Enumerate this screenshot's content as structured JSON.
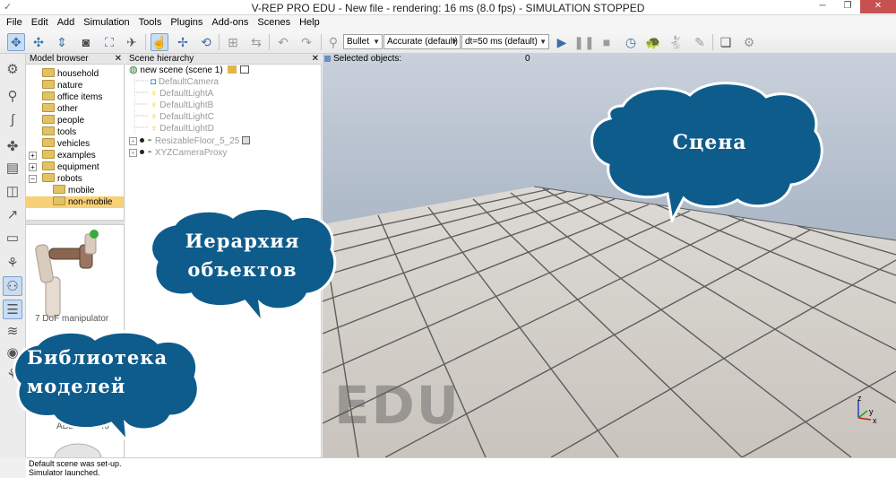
{
  "window": {
    "title": "V-REP PRO EDU - New file - rendering: 16 ms (8.0 fps) - SIMULATION STOPPED",
    "minimize": "─",
    "maximize": "❐",
    "close": "✕"
  },
  "menu": [
    "File",
    "Edit",
    "Add",
    "Simulation",
    "Tools",
    "Plugins",
    "Add-ons",
    "Scenes",
    "Help"
  ],
  "toolbar": {
    "engine": "Bullet",
    "accuracy": "Accurate (default)",
    "timestep": "dt=50 ms (default)"
  },
  "model_browser": {
    "title": "Model browser",
    "close": "✕",
    "items": [
      {
        "label": "household",
        "expander": ""
      },
      {
        "label": "nature",
        "expander": ""
      },
      {
        "label": "office items",
        "expander": ""
      },
      {
        "label": "other",
        "expander": ""
      },
      {
        "label": "people",
        "expander": ""
      },
      {
        "label": "tools",
        "expander": ""
      },
      {
        "label": "vehicles",
        "expander": ""
      },
      {
        "label": "examples",
        "expander": "+"
      },
      {
        "label": "equipment",
        "expander": "+"
      },
      {
        "label": "robots",
        "expander": "−"
      },
      {
        "label": "mobile",
        "expander": ""
      },
      {
        "label": "non-mobile",
        "expander": ""
      }
    ],
    "thumbnails": [
      "7 DoF manipulator",
      "ABB IRB 140"
    ]
  },
  "scene_hierarchy": {
    "title": "Scene hierarchy",
    "close": "✕",
    "root": "new scene (scene 1)",
    "items": [
      "DefaultCamera",
      "DefaultLightA",
      "DefaultLightB",
      "DefaultLightC",
      "DefaultLightD",
      "ResizableFloor_5_25",
      "XYZCameraProxy"
    ]
  },
  "scene": {
    "selected_label": "Selected objects:",
    "selected_count": "0",
    "watermark": "EDU",
    "axes": {
      "x": "x",
      "y": "y",
      "z": "z"
    }
  },
  "status": {
    "lines": [
      "Default scene was set-up.",
      "Simulator launched."
    ]
  },
  "annotations": {
    "scene": "Сцена",
    "hierarchy_line1": "Иерархия",
    "hierarchy_line2": "объектов",
    "library_line1": "Библиотека",
    "library_line2": "моделей"
  },
  "colors": {
    "bubble": "#0e5c8c",
    "bubble_outline": "#ffffff",
    "selection": "#f7d178",
    "active_tool": "#c8ddf3"
  },
  "icons": {
    "toolbar": [
      "move-camera-icon",
      "rotate-camera-icon",
      "shift-camera-icon",
      "camera-icon",
      "fit-view-icon",
      "dragonfly-icon",
      "click-select-icon",
      "object-shift-icon",
      "object-rotate-icon",
      "assemble-icon",
      "transfer-icon",
      "undo-icon",
      "redo-icon",
      "dynamics-icon",
      "play-icon",
      "pause-icon",
      "stop-icon",
      "realtime-icon",
      "slow-icon",
      "fast-icon",
      "threaded-rendering-icon",
      "page-icon",
      "layer-icon"
    ]
  }
}
